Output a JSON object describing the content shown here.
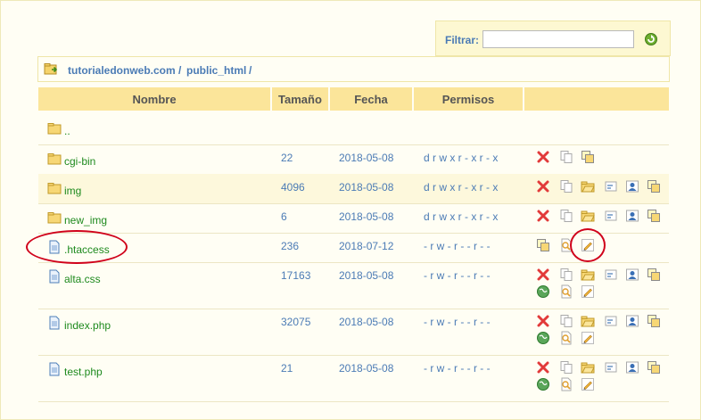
{
  "filter": {
    "label": "Filtrar:",
    "value": "",
    "placeholder": ""
  },
  "breadcrumb": [
    {
      "label": "tutorialedonweb.com"
    },
    {
      "label": "public_html"
    }
  ],
  "breadcrumb_sep": "/",
  "table": {
    "headers": {
      "name": "Nombre",
      "size": "Tamaño",
      "date": "Fecha",
      "perms": "Permisos"
    },
    "rows": [
      {
        "name": "..",
        "kind": "folder",
        "size": "",
        "date": "",
        "perms": "",
        "actions": []
      },
      {
        "name": "cgi-bin",
        "kind": "folder",
        "size": "22",
        "date": "2018-05-08",
        "perms": "d r w x r - x r - x",
        "actions": [
          "delete",
          "copy",
          "move"
        ]
      },
      {
        "name": "img",
        "kind": "folder",
        "size": "4096",
        "date": "2018-05-08",
        "perms": "d r w x r - x r - x",
        "actions": [
          "delete",
          "copy",
          "folder-open",
          "rename",
          "chown",
          "move"
        ]
      },
      {
        "name": "new_img",
        "kind": "folder",
        "size": "6",
        "date": "2018-05-08",
        "perms": "d r w x r - x r - x",
        "actions": [
          "delete",
          "copy",
          "folder-open",
          "rename",
          "chown",
          "move"
        ]
      },
      {
        "name": ".htaccess",
        "kind": "file",
        "size": "236",
        "date": "2018-07-12",
        "perms": "- r w - r - - r - -",
        "actions": [
          "move",
          "view",
          "edit"
        ]
      },
      {
        "name": "alta.css",
        "kind": "file",
        "size": "17163",
        "date": "2018-05-08",
        "perms": "- r w - r - - r - -",
        "actions": [
          "delete",
          "copy",
          "folder-open",
          "rename",
          "chown",
          "move",
          "web",
          "view",
          "edit"
        ]
      },
      {
        "name": "index.php",
        "kind": "file",
        "size": "32075",
        "date": "2018-05-08",
        "perms": "- r w - r - - r - -",
        "actions": [
          "delete",
          "copy",
          "folder-open",
          "rename",
          "chown",
          "move",
          "web",
          "view",
          "edit"
        ]
      },
      {
        "name": "test.php",
        "kind": "file",
        "size": "21",
        "date": "2018-05-08",
        "perms": "- r w - r - - r - -",
        "actions": [
          "delete",
          "copy",
          "folder-open",
          "rename",
          "chown",
          "move",
          "web",
          "view",
          "edit"
        ]
      }
    ]
  },
  "colors": {
    "header_bg": "#fbe59a",
    "link": "#4b7bb5",
    "filename": "#1e8a1e",
    "highlight": "#d0021b"
  }
}
